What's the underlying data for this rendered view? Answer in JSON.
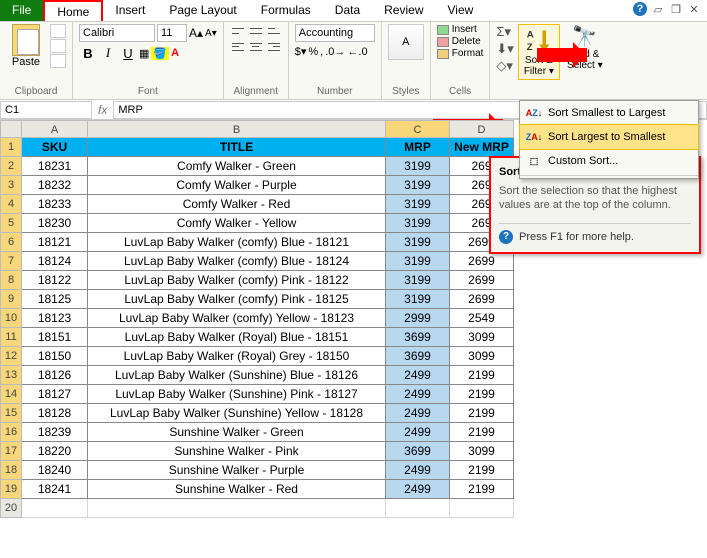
{
  "tabs": [
    "File",
    "Home",
    "Insert",
    "Page Layout",
    "Formulas",
    "Data",
    "Review",
    "View"
  ],
  "ribbon": {
    "clipboard": "Clipboard",
    "paste": "Paste",
    "font": "Font",
    "fontname": "Calibri",
    "fontsize": "11",
    "alignment": "Alignment",
    "number": "Number",
    "numberformat": "Accounting",
    "styles": "Styles",
    "cells": "Cells",
    "insert": "Insert",
    "delete": "Delete",
    "format": "Format",
    "sortfilter": "Sort & Filter ▾",
    "findselect": "Find & Select ▾"
  },
  "dropdown": {
    "smallest": "Sort Smallest to Largest",
    "largest": "Sort Largest to Smallest",
    "custom": "Custom Sort..."
  },
  "tooltip": {
    "title": "Sort Largest to Smallest",
    "body": "Sort the selection so that the highest values are at the top of the column.",
    "help": "Press F1 for more help."
  },
  "formulabar": {
    "name": "C1",
    "fx": "fx",
    "value": "MRP"
  },
  "colheads": [
    "A",
    "B",
    "C",
    "D"
  ],
  "headers": {
    "sku": "SKU",
    "title": "TITLE",
    "mrp": "MRP",
    "newmrp": "New MRP"
  },
  "rows": [
    {
      "n": 1
    },
    {
      "n": 2,
      "sku": "18231",
      "title": "Comfy Walker - Green",
      "mrp": "3199",
      "new": "269"
    },
    {
      "n": 3,
      "sku": "18232",
      "title": "Comfy Walker - Purple",
      "mrp": "3199",
      "new": "269"
    },
    {
      "n": 4,
      "sku": "18233",
      "title": "Comfy Walker - Red",
      "mrp": "3199",
      "new": "269"
    },
    {
      "n": 5,
      "sku": "18230",
      "title": "Comfy Walker - Yellow",
      "mrp": "3199",
      "new": "269"
    },
    {
      "n": 6,
      "sku": "18121",
      "title": "LuvLap Baby Walker (comfy) Blue - 18121",
      "mrp": "3199",
      "new": "2699"
    },
    {
      "n": 7,
      "sku": "18124",
      "title": "LuvLap Baby Walker (comfy) Blue - 18124",
      "mrp": "3199",
      "new": "2699"
    },
    {
      "n": 8,
      "sku": "18122",
      "title": "LuvLap Baby Walker (comfy) Pink - 18122",
      "mrp": "3199",
      "new": "2699"
    },
    {
      "n": 9,
      "sku": "18125",
      "title": "LuvLap Baby Walker (comfy) Pink - 18125",
      "mrp": "3199",
      "new": "2699"
    },
    {
      "n": 10,
      "sku": "18123",
      "title": "LuvLap Baby Walker (comfy) Yellow - 18123",
      "mrp": "2999",
      "new": "2549"
    },
    {
      "n": 11,
      "sku": "18151",
      "title": "LuvLap Baby Walker (Royal) Blue - 18151",
      "mrp": "3699",
      "new": "3099"
    },
    {
      "n": 12,
      "sku": "18150",
      "title": "LuvLap Baby Walker (Royal) Grey - 18150",
      "mrp": "3699",
      "new": "3099"
    },
    {
      "n": 13,
      "sku": "18126",
      "title": "LuvLap Baby Walker (Sunshine) Blue - 18126",
      "mrp": "2499",
      "new": "2199"
    },
    {
      "n": 14,
      "sku": "18127",
      "title": "LuvLap Baby Walker (Sunshine) Pink - 18127",
      "mrp": "2499",
      "new": "2199"
    },
    {
      "n": 15,
      "sku": "18128",
      "title": "LuvLap Baby Walker (Sunshine) Yellow - 18128",
      "mrp": "2499",
      "new": "2199"
    },
    {
      "n": 16,
      "sku": "18239",
      "title": "Sunshine Walker - Green",
      "mrp": "2499",
      "new": "2199"
    },
    {
      "n": 17,
      "sku": "18220",
      "title": "Sunshine Walker - Pink",
      "mrp": "3699",
      "new": "3099"
    },
    {
      "n": 18,
      "sku": "18240",
      "title": "Sunshine Walker - Purple",
      "mrp": "2499",
      "new": "2199"
    },
    {
      "n": 19,
      "sku": "18241",
      "title": "Sunshine Walker - Red",
      "mrp": "2499",
      "new": "2199"
    }
  ]
}
